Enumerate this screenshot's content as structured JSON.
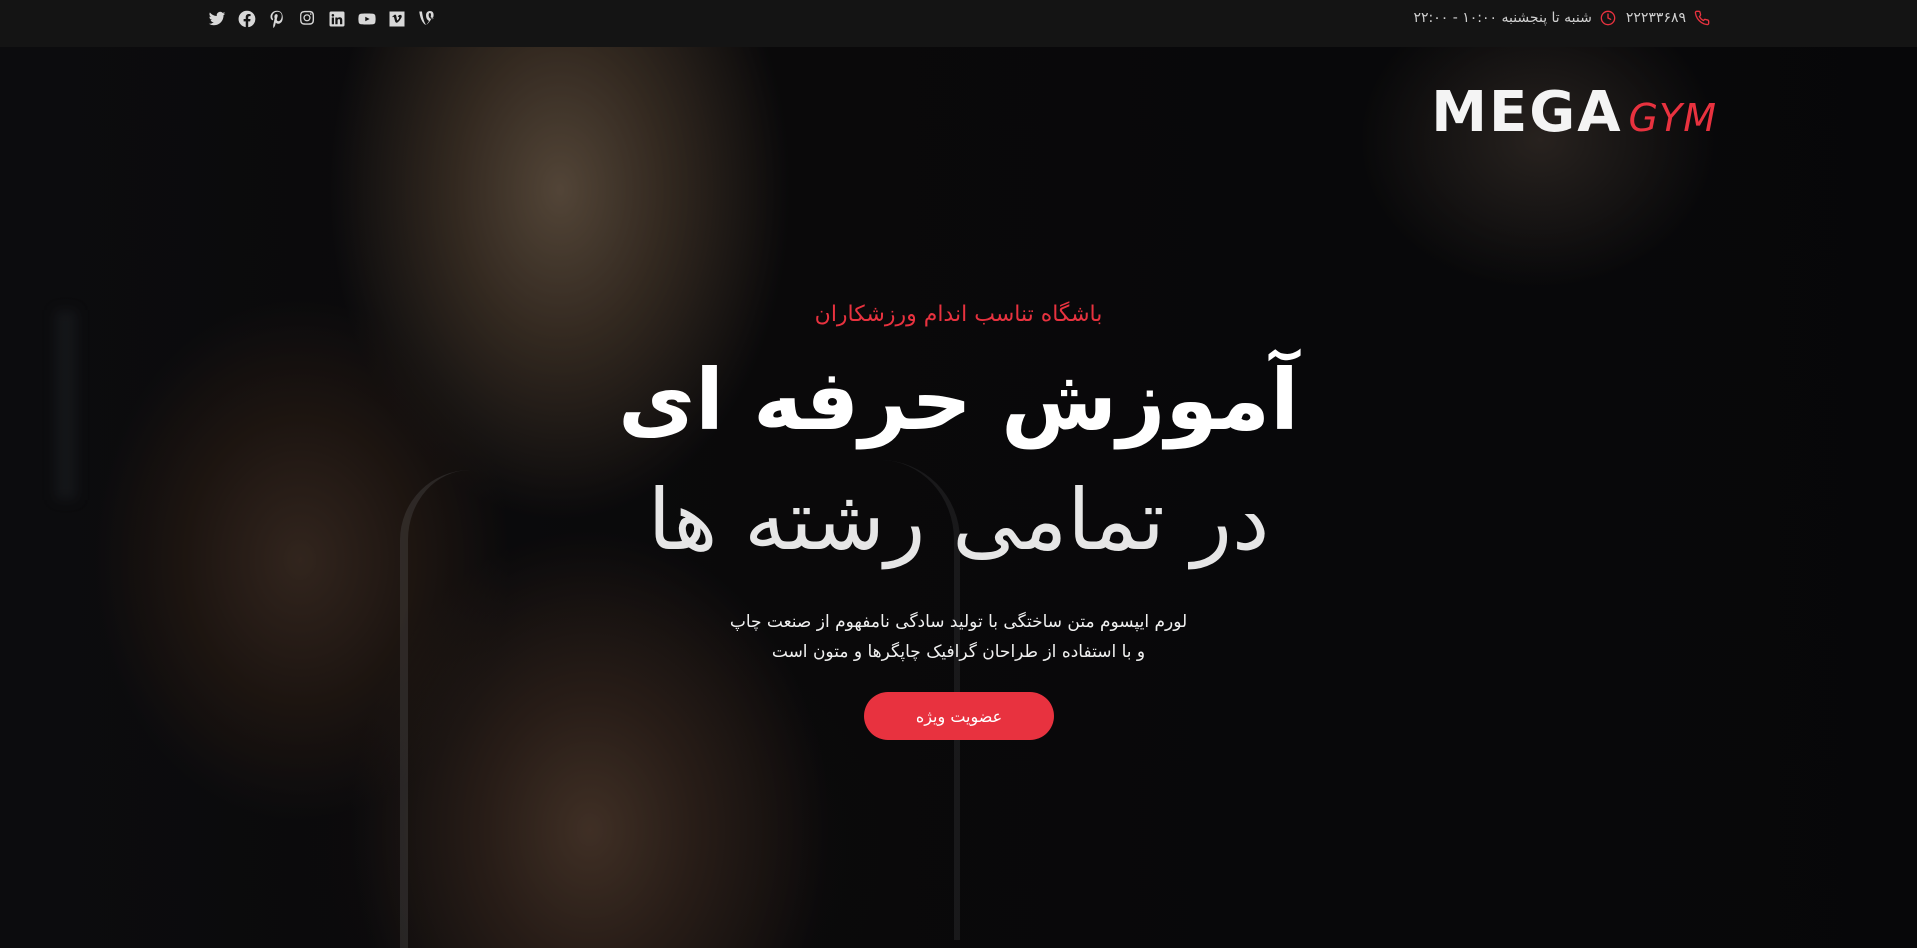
{
  "topbar": {
    "phone": "۲۲۲۳۳۶۸۹",
    "hours": "شنبه تا پنجشنبه ۱۰:۰۰ - ۲۲:۰۰",
    "phone_icon": "phone-icon",
    "clock_icon": "clock-icon",
    "socials": [
      "twitter-icon",
      "facebook-icon",
      "pinterest-icon",
      "instagram-icon",
      "linkedin-icon",
      "youtube-icon",
      "vimeo-icon",
      "vine-icon"
    ]
  },
  "logo": {
    "primary": "MEGA",
    "secondary": "GYM"
  },
  "hero": {
    "subtitle": "باشگاه تناسب اندام ورزشکاران",
    "title_line1": "آموزش حرفه ای",
    "title_line2": "در تمامی رشته ها",
    "desc_line1": "لورم ایپسوم متن ساختگی با تولید سادگی نامفهوم از صنعت چاپ",
    "desc_line2": "و با استفاده از طراحان گرافیک چاپگرها و متون است",
    "cta_label": "عضویت ویژه"
  },
  "colors": {
    "accent": "#e8323f",
    "topbar_bg": "#141414",
    "text": "#ffffff"
  }
}
